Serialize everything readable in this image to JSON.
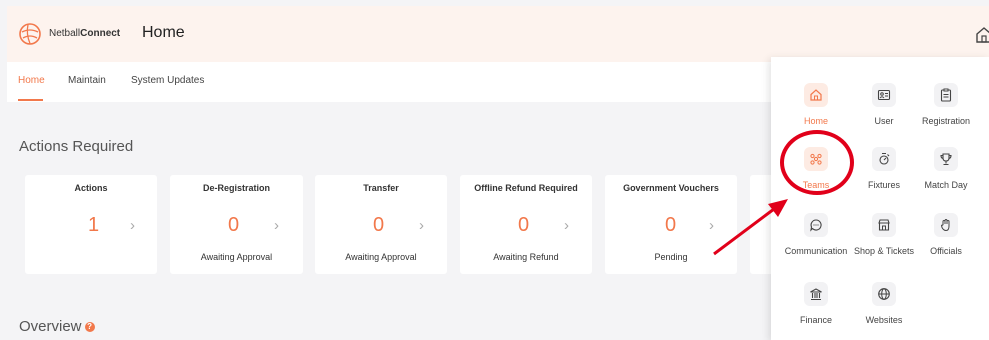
{
  "header": {
    "brand_prefix": "Netball",
    "brand_suffix": "Connect",
    "title": "Home"
  },
  "subnav": {
    "tabs": [
      {
        "label": "Home",
        "active": true
      },
      {
        "label": "Maintain",
        "active": false
      },
      {
        "label": "System Updates",
        "active": false
      }
    ]
  },
  "actions": {
    "title": "Actions Required",
    "cards": [
      {
        "title": "Actions",
        "value": "1",
        "subtitle": ""
      },
      {
        "title": "De-Registration",
        "value": "0",
        "subtitle": "Awaiting Approval"
      },
      {
        "title": "Transfer",
        "value": "0",
        "subtitle": "Awaiting Approval"
      },
      {
        "title": "Offline Refund Required",
        "value": "0",
        "subtitle": "Awaiting Refund"
      },
      {
        "title": "Government Vouchers",
        "value": "0",
        "subtitle": "Pending"
      }
    ]
  },
  "overview": {
    "title": "Overview",
    "help_icon": "?"
  },
  "menu": {
    "items": [
      {
        "label": "Home",
        "icon": "home-icon",
        "active": true
      },
      {
        "label": "User",
        "icon": "id-card-icon",
        "active": false
      },
      {
        "label": "Registration",
        "icon": "clipboard-icon",
        "active": false
      },
      {
        "label": "Teams",
        "icon": "teams-icon",
        "active": true
      },
      {
        "label": "Fixtures",
        "icon": "fixtures-icon",
        "active": false
      },
      {
        "label": "Match Day",
        "icon": "trophy-icon",
        "active": false
      },
      {
        "label": "Communication",
        "icon": "chat-icon",
        "active": false
      },
      {
        "label": "Shop & Tickets",
        "icon": "shop-icon",
        "active": false
      },
      {
        "label": "Officials",
        "icon": "hand-icon",
        "active": false
      },
      {
        "label": "Finance",
        "icon": "bank-icon",
        "active": false
      },
      {
        "label": "Websites",
        "icon": "globe-icon",
        "active": false
      }
    ]
  },
  "colors": {
    "accent": "#f2784b",
    "annotation": "#e1001a",
    "header_bg": "#fdf3ee"
  }
}
